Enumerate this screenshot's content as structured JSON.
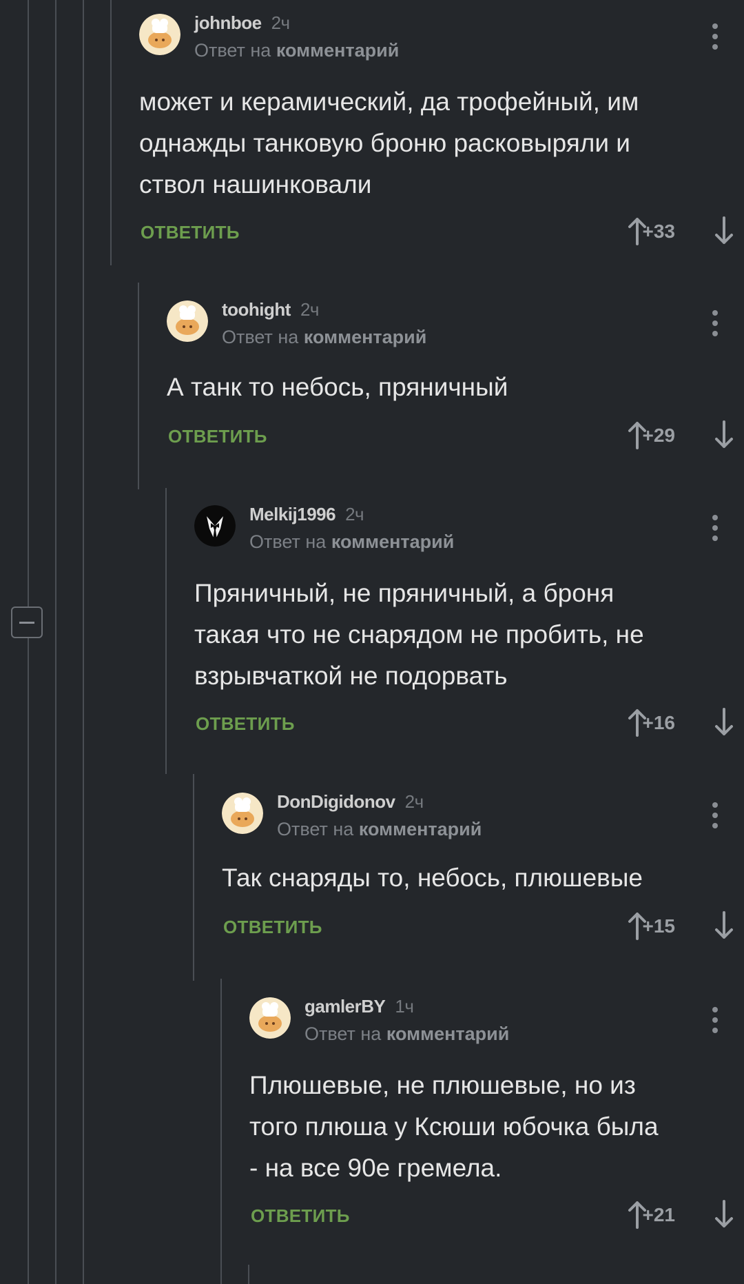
{
  "colors": {
    "background": "#24272b",
    "reply_green": "#6d9e4e",
    "thread_line": "#4a4e54",
    "text": "#e6e6e6",
    "muted": "#7c8086"
  },
  "comments": [
    {
      "username": "johnboe",
      "time": "2ч",
      "reply_prefix": "Ответ на",
      "reply_target": "комментарий",
      "lines": [
        "может и керамический, да трофейный, им",
        "однажды танковую броню расковыряли и",
        "ствол нашинковали"
      ],
      "reply_label": "ОТВЕТИТЬ",
      "score": "+33",
      "avatar": "chef-avatar-icon"
    },
    {
      "username": "toohight",
      "time": "2ч",
      "reply_prefix": "Ответ на",
      "reply_target": "комментарий",
      "lines": [
        "А танк то небось, пряничный"
      ],
      "reply_label": "ОТВЕТИТЬ",
      "score": "+29",
      "avatar": "chef-avatar-icon"
    },
    {
      "username": "Melkij1996",
      "time": "2ч",
      "reply_prefix": "Ответ на",
      "reply_target": "комментарий",
      "lines": [
        "Пряничный, не пряничный, а броня",
        "такая что не снарядом не пробить, не",
        "взрывчаткой не подорвать"
      ],
      "reply_label": "ОТВЕТИТЬ",
      "score": "+16",
      "avatar": "suit-avatar-icon"
    },
    {
      "username": "DonDigidonov",
      "time": "2ч",
      "reply_prefix": "Ответ на",
      "reply_target": "комментарий",
      "lines": [
        "Так снаряды то, небось, плюшевые"
      ],
      "reply_label": "ОТВЕТИТЬ",
      "score": "+15",
      "avatar": "chef-avatar-icon"
    },
    {
      "username": "gamlerBY",
      "time": "1ч",
      "reply_prefix": "Ответ на",
      "reply_target": "комментарий",
      "lines": [
        "Плюшевые, не плюшевые, но из",
        "того плюша у Ксюши юбочка была",
        "- на все 90е гремела."
      ],
      "reply_label": "ОТВЕТИТЬ",
      "score": "+21",
      "avatar": "chef-avatar-icon"
    }
  ]
}
